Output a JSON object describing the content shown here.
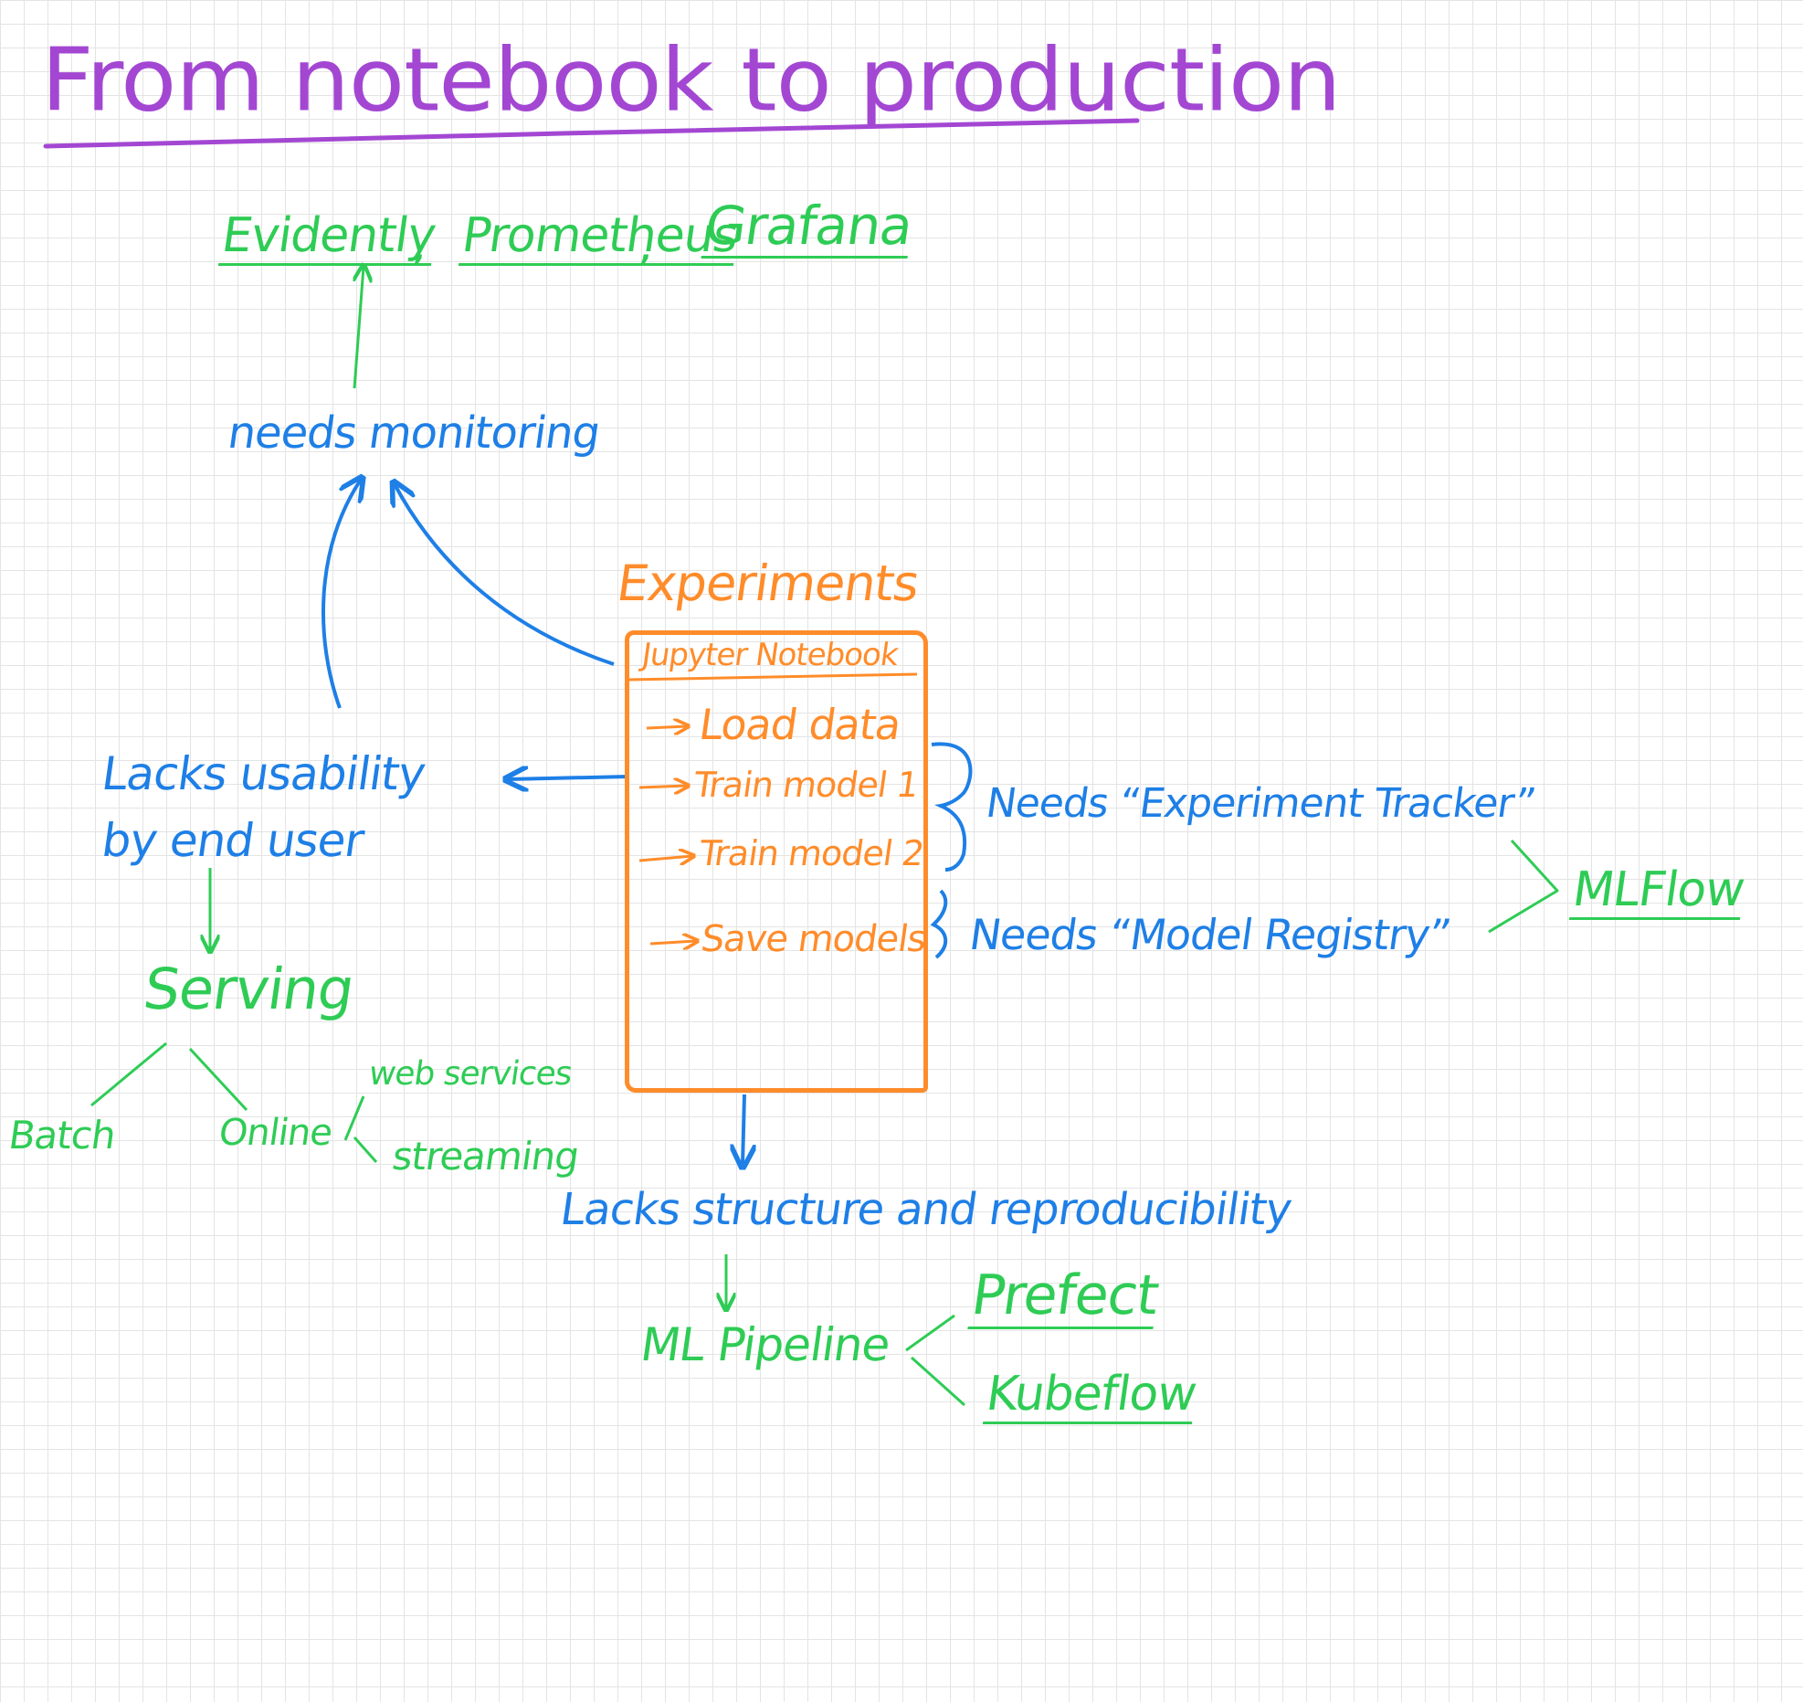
{
  "colors": {
    "purple": "#a347d3",
    "green": "#2ecc55",
    "blue": "#1e7fe6",
    "orange": "#ff8c2a"
  },
  "title": "From notebook to production",
  "monitoring": {
    "tools": [
      "Evidently",
      "Prometheus",
      "Grafana"
    ],
    "separators": [
      ",",
      ","
    ],
    "label": "needs monitoring"
  },
  "experiments": {
    "label": "Experiments",
    "notebook_title": "Jupyter Notebook",
    "steps": [
      "Load data",
      "Train model 1",
      "Train model 2",
      "Save models"
    ]
  },
  "tracking": {
    "tracker_need": "Needs “Experiment Tracker”",
    "registry_need": "Needs “Model Registry”",
    "tool": "MLFlow"
  },
  "usability": {
    "line1": "Lacks usability",
    "line2": "by end user"
  },
  "serving": {
    "label": "Serving",
    "batch": "Batch",
    "online": "Online",
    "online_modes": [
      "web services",
      "streaming"
    ]
  },
  "pipeline": {
    "need": "Lacks structure and reproducibility",
    "label": "ML Pipeline",
    "tools": [
      "Prefect",
      "Kubeflow"
    ]
  }
}
